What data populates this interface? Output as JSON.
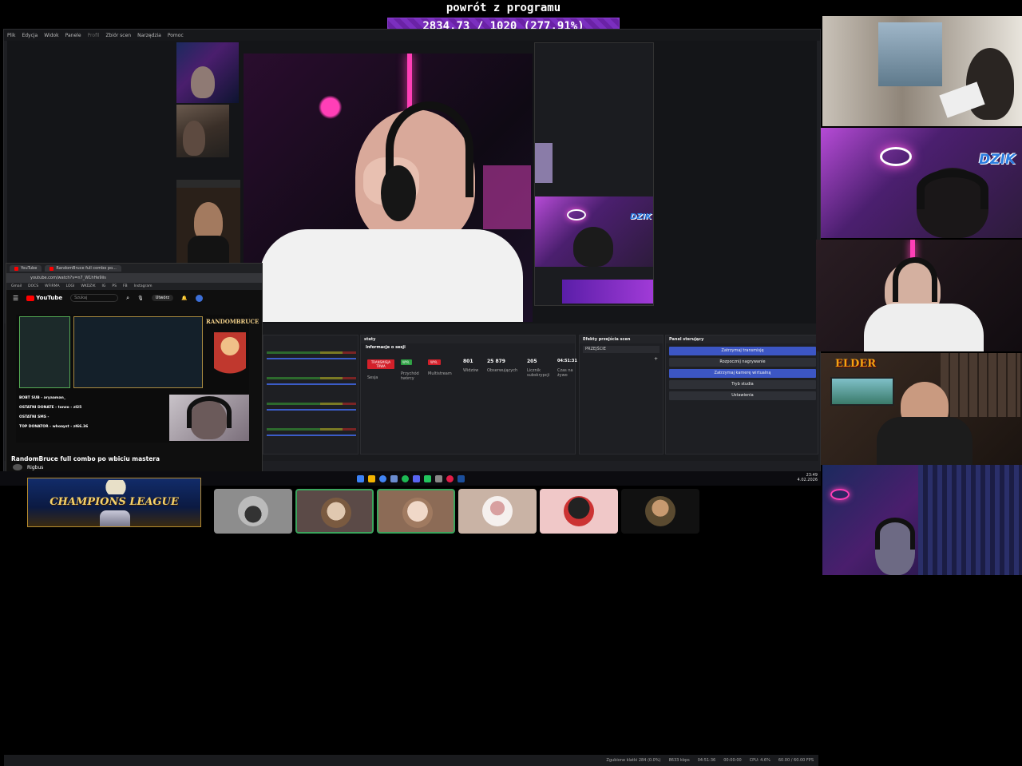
{
  "goal": {
    "title": "powrót z programu",
    "progress_text": "2834.73 / 1020 (277.91%)",
    "progress_fraction": 1.0
  },
  "obs": {
    "menu": [
      "Plik",
      "Edycja",
      "Widok",
      "Panele",
      "Profil",
      "Zbiór scen",
      "Narzędzia",
      "Pomoc"
    ],
    "stats_dock": {
      "title": "staty",
      "header": "Informacje o sesji",
      "badges": [
        {
          "text": "TRANSMISJA TRWA",
          "color": "#d3202a"
        },
        {
          "text": "WYŁ.",
          "color": "#2ea043"
        },
        {
          "text": "WYŁ.",
          "color": "#d3202a"
        }
      ],
      "badge_labels": [
        "Sesja",
        "Przychód twórcy",
        "Multistream"
      ],
      "stats": [
        {
          "value": "801",
          "label": "Widzów"
        },
        {
          "value": "25 879",
          "label": "Obserwujących"
        },
        {
          "value": "205",
          "label": "Licznik subskrypcji"
        },
        {
          "value": "04:51:31",
          "label": "Czas na żywo"
        }
      ]
    },
    "transitions_dock": {
      "title": "Efekty przejścia scen",
      "selected": "PRZEJŚCIE"
    },
    "control_dock": {
      "title": "Panel sterujący",
      "buttons": [
        {
          "label": "Zatrzymaj transmisję",
          "active": true
        },
        {
          "label": "Rozpocznij nagrywanie",
          "active": false
        },
        {
          "label": "Zatrzymaj kamerę wirtualną",
          "active": true
        },
        {
          "label": "Tryb studia",
          "active": false
        },
        {
          "label": "Ustawienia",
          "active": false
        }
      ]
    },
    "status_bar": [
      "Zgubione klatki 284 (0.0%)",
      "8633 kbps",
      "04:51:36",
      "00:00:00",
      "CPU: 4.6%",
      "60.00 / 60.00 FPS"
    ]
  },
  "browser": {
    "tabs": [
      "YouTube",
      "RandomBruce full combo po..."
    ],
    "url": "youtube.com/watch?v=n7_W1hHe9iis",
    "bookmarks": [
      "Gmail",
      "DOCS",
      "WFIRMA",
      "LOGI",
      "WKDZIK",
      "IG",
      "PS",
      "FB",
      "Instagram"
    ],
    "search_placeholder": "Szukaj",
    "create_label": "Utwórz",
    "logo": "YouTube",
    "video_title": "RandomBruce full combo po wbiciu mastera",
    "channel": "Rigbus",
    "overlay_name": "RANDOMBRUCE",
    "overlay_rows": [
      "BOBT SUB - aryaaman_",
      "OSTATNI DONATE - tonzo - zł25",
      "OSTATNI SMS -",
      "TOP DONATOR - whoayst - zł66.36"
    ]
  },
  "taskbar": {
    "time": "23:49",
    "date": "4.02.2026"
  },
  "champions": {
    "text": "CHAMPIONS LEAGUE"
  },
  "cams": {
    "dzik_label": "DZIK",
    "elder_label": "ELDER"
  },
  "colors": {
    "goal_bar": "#6b20a8",
    "obs_active_button": "#3c56c4",
    "neon_pink": "#ff3fb7"
  }
}
